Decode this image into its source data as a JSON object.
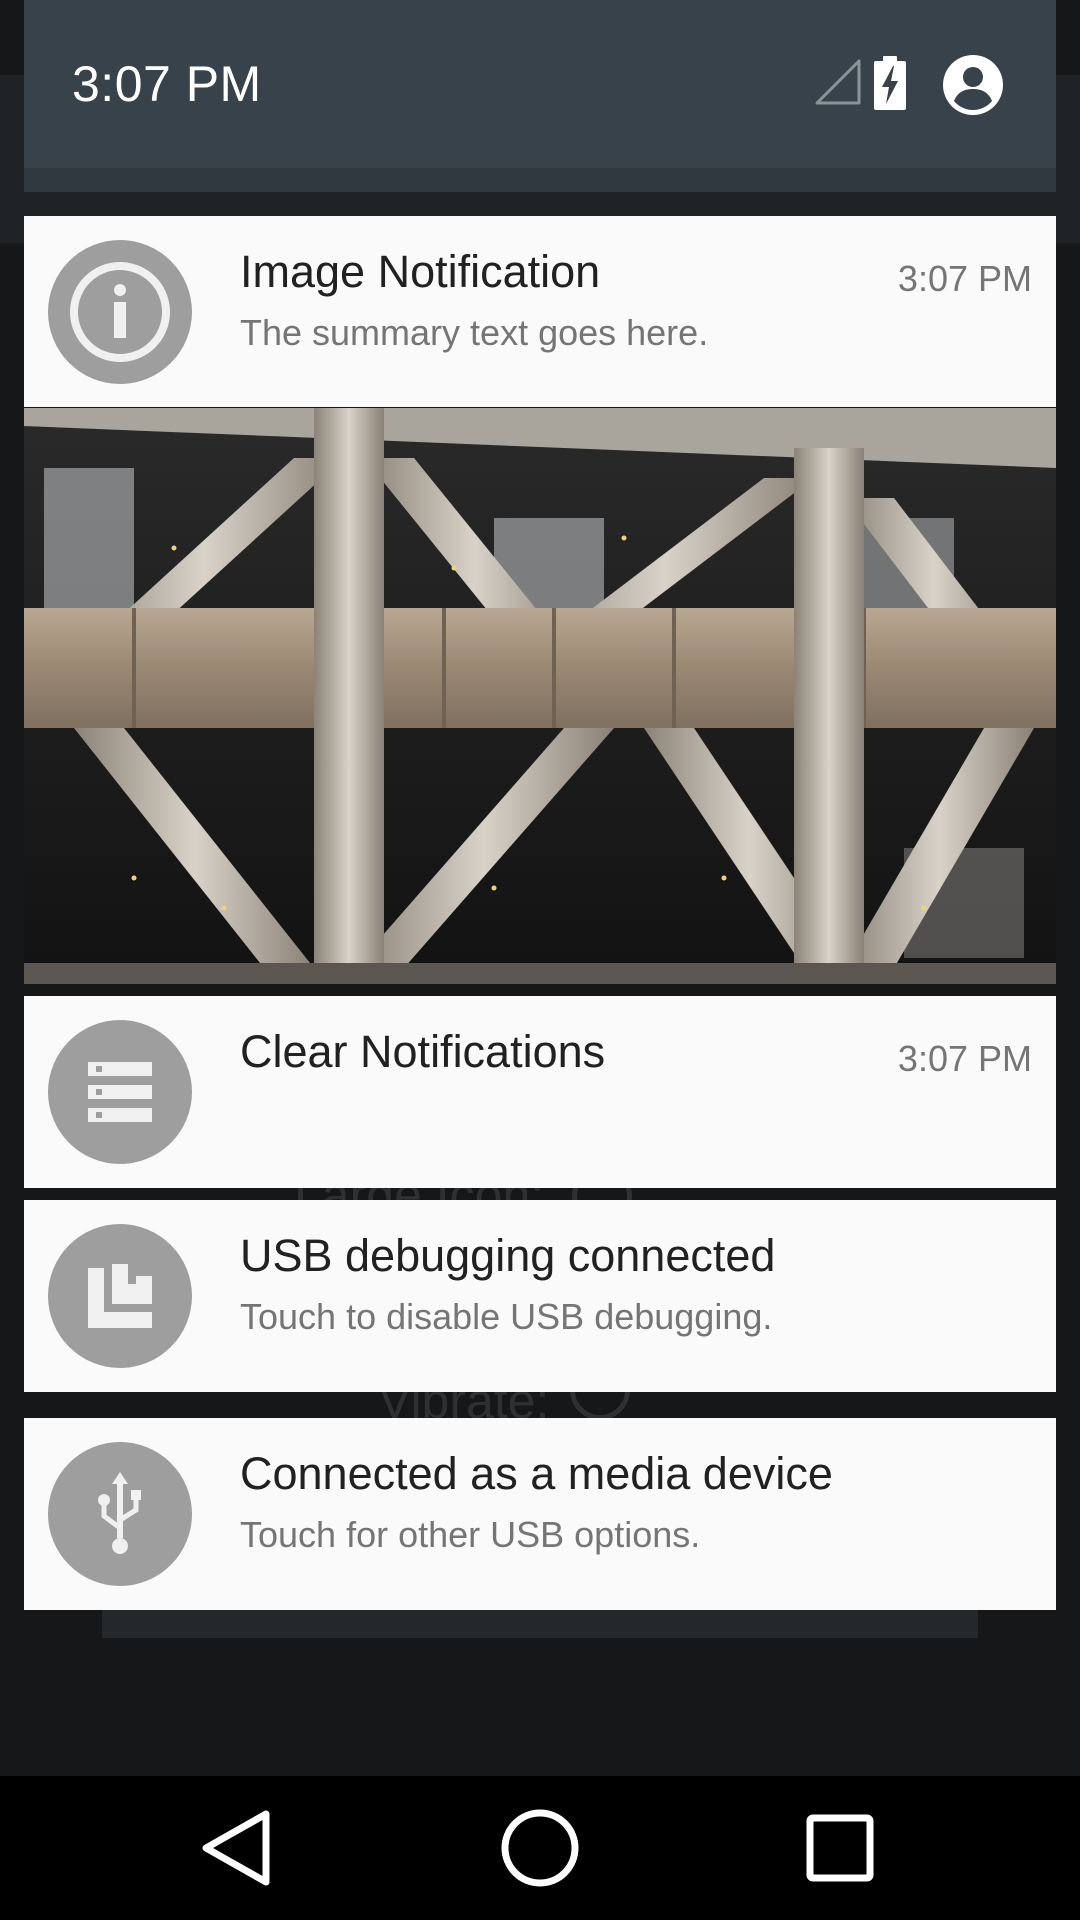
{
  "app_background": {
    "ghost_labels": [
      "Large Icon:",
      "Vibrate:"
    ]
  },
  "status_header": {
    "time": "3:07 PM",
    "icons": [
      "cell-signal-empty-icon",
      "battery-charging-icon",
      "account-icon"
    ]
  },
  "notifications": [
    {
      "icon": "info-icon",
      "title": "Image Notification",
      "summary": "The summary text goes here.",
      "time": "3:07 PM",
      "has_big_picture": true
    },
    {
      "icon": "list-icon",
      "title": "Clear Notifications",
      "summary": "",
      "time": "3:07 PM"
    },
    {
      "icon": "usb-debug-icon",
      "title": "USB debugging connected",
      "summary": "Touch to disable USB debugging."
    },
    {
      "icon": "usb-icon",
      "title": "Connected as a media device",
      "summary": "Touch for other USB options."
    }
  ],
  "navbar": {
    "buttons": [
      "back-icon",
      "home-icon",
      "recents-icon"
    ]
  },
  "colors": {
    "header_bg": "#37424a",
    "card_bg": "#fafafa",
    "icon_circle": "#9e9e9e",
    "title_text": "#212121",
    "secondary_text": "#757575"
  }
}
